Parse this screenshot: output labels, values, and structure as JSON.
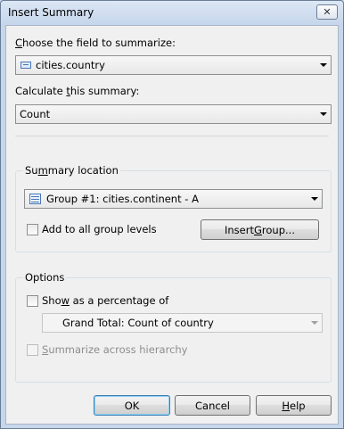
{
  "window": {
    "title": "Insert Summary",
    "close_glyph": "✕"
  },
  "field_section": {
    "label_pre": "",
    "label_access": "C",
    "label_post": "hoose the field to summarize:",
    "value": "cities.country",
    "icon": "database-field-icon"
  },
  "summary_section": {
    "label_pre": "Calculate ",
    "label_access": "t",
    "label_post": "his summary:",
    "value": "Count"
  },
  "location_group": {
    "title_pre": "Su",
    "title_access": "m",
    "title_post": "mary location",
    "value": "Group #1: cities.continent - A",
    "icon": "group-icon",
    "add_all_label": "Add to all group levels",
    "add_all_checked": false,
    "insert_group_pre": "Insert ",
    "insert_group_access": "G",
    "insert_group_post": "roup..."
  },
  "options_group": {
    "title": "Options",
    "percentage_pre": "Sho",
    "percentage_access": "w",
    "percentage_post": " as a percentage of",
    "percentage_checked": false,
    "percentage_value": "Grand Total: Count of country",
    "summarize_pre": "",
    "summarize_access": "S",
    "summarize_post": "ummarize across hierarchy",
    "summarize_checked": false,
    "summarize_enabled": false
  },
  "buttons": {
    "ok": "OK",
    "cancel": "Cancel",
    "help_access": "H",
    "help_post": "elp"
  }
}
